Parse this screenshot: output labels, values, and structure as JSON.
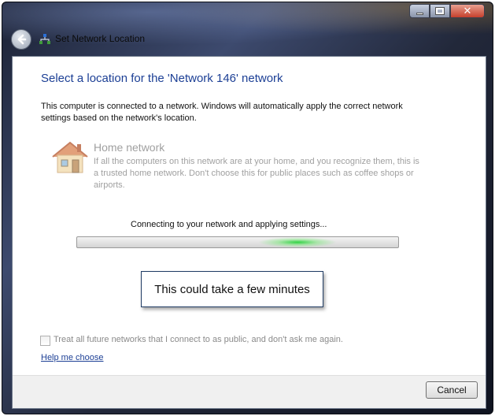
{
  "window": {
    "title": "Set Network Location",
    "icons": [
      "back-arrow-icon",
      "network-icon",
      "minimize-icon",
      "maximize-icon",
      "close-icon"
    ]
  },
  "main": {
    "heading": "Select a location for the 'Network  146' network",
    "description": "This computer is connected to a network. Windows will automatically apply the correct network settings based on the network's location.",
    "option": {
      "icon": "house-icon",
      "title": "Home network",
      "description": "If all the computers on this network are at your home, and you recognize them, this is a trusted home network.  Don't choose this for public places such as coffee shops or airports."
    },
    "status_text": "Connecting to your network and applying settings...",
    "progress": {
      "state": "indeterminate",
      "accent": "#2ad23c"
    },
    "callout": "This could take a few minutes",
    "checkbox": {
      "label": "Treat all future networks that I connect to as public, and don't ask me again.",
      "checked": false
    },
    "help_link": "Help me choose"
  },
  "footer": {
    "cancel_label": "Cancel"
  },
  "colors": {
    "heading": "#1c3f95",
    "link": "#1c3f95",
    "disabled_text": "#a0a0a0"
  }
}
